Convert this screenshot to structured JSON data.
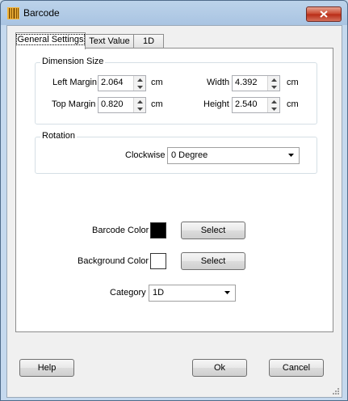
{
  "window": {
    "title": "Barcode",
    "icon": "barcode-icon",
    "close_icon": "close-icon"
  },
  "tabs": [
    {
      "label": "General Settings",
      "active": true
    },
    {
      "label": "Text Value",
      "active": false
    },
    {
      "label": "1D",
      "active": false
    }
  ],
  "dimension": {
    "title": "Dimension Size",
    "left_margin": {
      "label": "Left Margin",
      "value": "2.064",
      "unit": "cm"
    },
    "top_margin": {
      "label": "Top Margin",
      "value": "0.820",
      "unit": "cm"
    },
    "width": {
      "label": "Width",
      "value": "4.392",
      "unit": "cm"
    },
    "height": {
      "label": "Height",
      "value": "2.540",
      "unit": "cm"
    }
  },
  "rotation": {
    "title": "Rotation",
    "clockwise_label": "Clockwise",
    "clockwise_value": "0 Degree"
  },
  "barcode_color": {
    "label": "Barcode Color",
    "color": "#000000",
    "button": "Select"
  },
  "background_color": {
    "label": "Background Color",
    "color": "#ffffff",
    "button": "Select"
  },
  "category": {
    "label": "Category",
    "value": "1D"
  },
  "footer": {
    "help": "Help",
    "ok": "Ok",
    "cancel": "Cancel"
  }
}
